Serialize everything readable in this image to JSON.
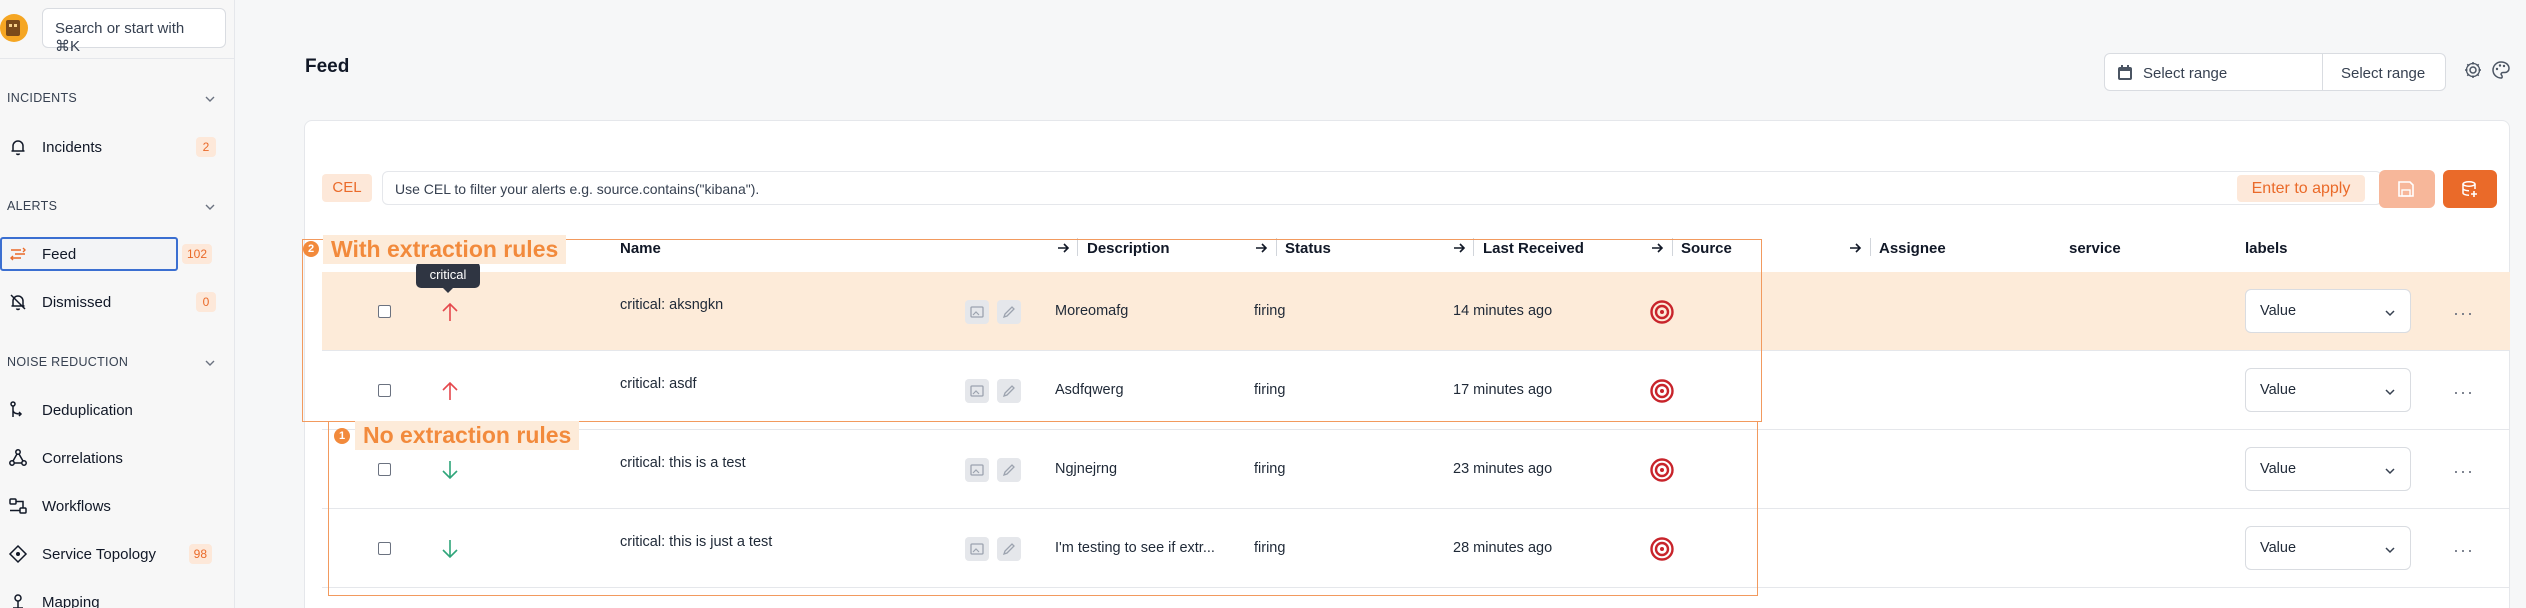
{
  "sidebar": {
    "search_placeholder": "Search or start with ⌘K",
    "sections": [
      {
        "title": "INCIDENTS"
      },
      {
        "title": "ALERTS"
      },
      {
        "title": "NOISE REDUCTION"
      }
    ],
    "items": [
      {
        "label": "Incidents",
        "badge": "2"
      },
      {
        "label": "Feed",
        "badge": "102"
      },
      {
        "label": "Dismissed",
        "badge": "0"
      },
      {
        "label": "Deduplication"
      },
      {
        "label": "Correlations"
      },
      {
        "label": "Workflows"
      },
      {
        "label": "Service Topology",
        "badge": "98"
      },
      {
        "label": "Mapping"
      }
    ]
  },
  "header": {
    "title": "Feed",
    "range_label_1": "Select range",
    "range_label_2": "Select range"
  },
  "filter": {
    "badge": "CEL",
    "placeholder": "Use CEL to filter your alerts e.g. source.contains(\"kibana\").",
    "apply_label": "Enter to apply"
  },
  "table": {
    "headers": [
      "Name",
      "Description",
      "Status",
      "Last Received",
      "Source",
      "Assignee",
      "service",
      "labels"
    ],
    "rows": [
      {
        "name": "critical: aksngkn",
        "description": "Moreomafg",
        "status": "firing",
        "last_received": "14 minutes ago",
        "label_value": "Value",
        "severity": "up"
      },
      {
        "name": "critical: asdf",
        "description": "Asdfqwerg",
        "status": "firing",
        "last_received": "17 minutes ago",
        "label_value": "Value",
        "severity": "up"
      },
      {
        "name": "critical: this is a test",
        "description": "Ngjnejrng",
        "status": "firing",
        "last_received": "23 minutes ago",
        "label_value": "Value",
        "severity": "down"
      },
      {
        "name": "critical: this is just a test",
        "description": "I'm testing to see if extr...",
        "status": "firing",
        "last_received": "28 minutes ago",
        "label_value": "Value",
        "severity": "down"
      }
    ],
    "more_icon": "···",
    "tooltip": "critical"
  },
  "annotations": {
    "with_rules": {
      "number": "2",
      "label": "With extraction rules"
    },
    "no_rules": {
      "number": "1",
      "label": "No extraction rules"
    }
  },
  "colors": {
    "accent": "#ea6a29",
    "accent_light": "#fdebd9",
    "severity_up": "#e5484d",
    "severity_down": "#2fa57a",
    "source_icon": "#c8242b"
  }
}
